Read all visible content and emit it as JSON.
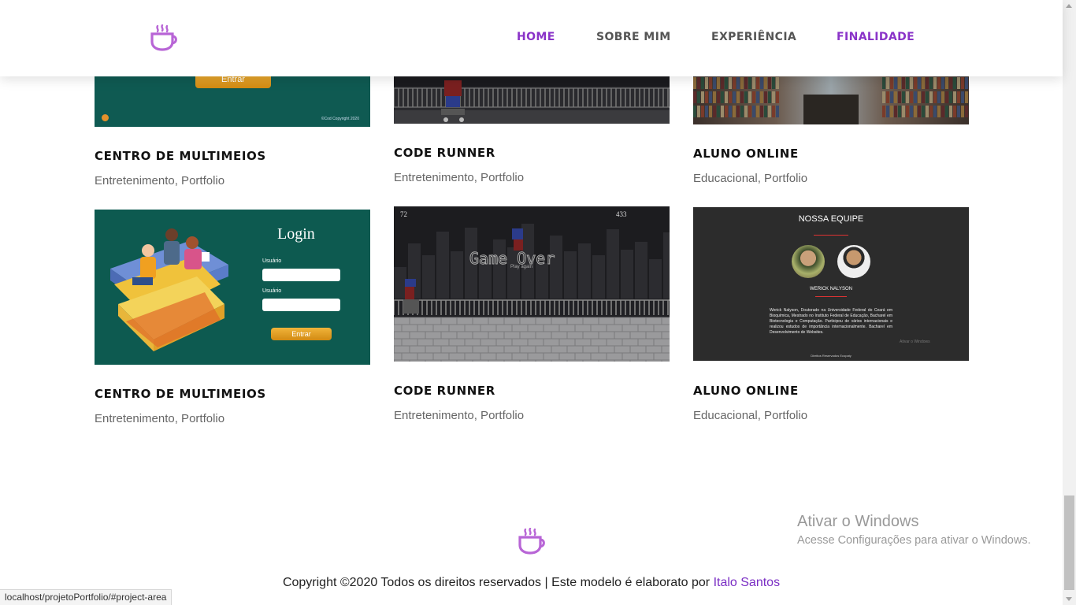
{
  "header": {
    "nav": [
      {
        "label": "HOME",
        "active": true
      },
      {
        "label": "SOBRE MIM",
        "active": false
      },
      {
        "label": "EXPERIÊNCIA",
        "active": false
      },
      {
        "label": "FINALIDADE",
        "active": false
      }
    ],
    "logo_icon": "coffee-cup-icon"
  },
  "projects_row1": [
    {
      "title": "CENTRO DE MULTIMEIOS",
      "tags": "Entretenimento, Portfolio",
      "thumb_button": "Entrar",
      "thumb_footer": "©Cod Copyright 2020"
    },
    {
      "title": "CODE RUNNER",
      "tags": "Entretenimento, Portfolio"
    },
    {
      "title": "ALUNO ONLINE",
      "tags": "Educacional, Portfolio"
    }
  ],
  "projects_row2": [
    {
      "title": "CENTRO DE MULTIMEIOS",
      "tags": "Entretenimento, Portfolio",
      "thumb": {
        "heading": "Login",
        "field1": "Usuário",
        "field2": "Usuário",
        "button": "Entrar"
      }
    },
    {
      "title": "CODE RUNNER",
      "tags": "Entretenimento, Portfolio",
      "thumb": {
        "score_left": "72",
        "score_right": "433",
        "game_over": "Game Over",
        "play_again": "Play again"
      }
    },
    {
      "title": "ALUNO ONLINE",
      "tags": "Educacional, Portfolio",
      "thumb": {
        "heading": "NOSSA EQUIPE",
        "member": "WERICK NALYSON",
        "bio": "Werick Nalyson, Doutorado na Universidade Federal do Ceará em Bioquímica, Mestrado no Instituto Federal de Educação, Bacharel em Biotecnologia e Computação. Participou de vários internacionais e realizou estudos de importância internacionalmente. Bacharel em Desenvolvimento de Websites.",
        "watermark": "Ativar o Windows",
        "footer": "Direitos Reservados Ecopaty"
      }
    }
  ],
  "footer": {
    "copyright_text": "Copyright ©2020 Todos os direitos reservados | Este modelo é elaborato por ",
    "author": "Italo Santos"
  },
  "windows_watermark": {
    "line1": "Ativar o Windows",
    "line2": "Acesse Configurações para ativar o Windows."
  },
  "status_url": "localhost/projetoPortfolio/#project-area",
  "colors": {
    "accent": "#8a33c8",
    "logo": "#b865d6",
    "teal": "#0e5c53",
    "dark": "#2c2c2c"
  }
}
